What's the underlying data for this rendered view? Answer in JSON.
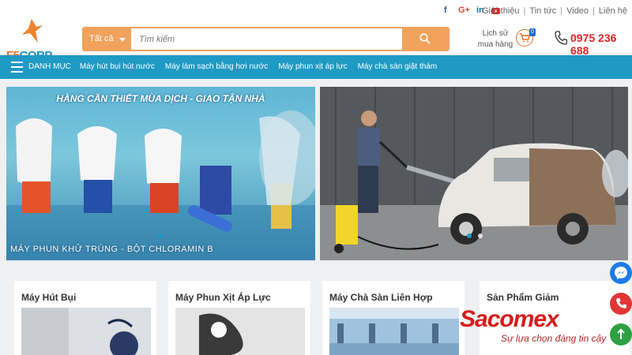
{
  "social": {
    "facebook": "f",
    "google": "G+",
    "linkedin": "in",
    "youtube": "youtube-icon"
  },
  "top_links": [
    "Giới thiệu",
    "Tin tức",
    "Video",
    "Liên hệ"
  ],
  "logo": {
    "text_a": "F5",
    "text_b": "CORP"
  },
  "search": {
    "category": "Tất cả",
    "placeholder": "Tìm kiếm"
  },
  "history": {
    "line1": "Lịch sử",
    "line2": "mua hàng"
  },
  "cart": {
    "count": "0"
  },
  "phone": "0975 236 688",
  "nav": {
    "menu_label": "DANH MỤC",
    "items": [
      "Máy hút bụi hút nước",
      "Máy làm sạch bằng hơi nước",
      "Máy phun xịt áp lực",
      "Máy chà sàn giặt thảm"
    ]
  },
  "banner_left": {
    "headline": "HÀNG CẦN THIẾT MÙA DỊCH - GIAO TẬN NHÀ",
    "caption": "MÁY PHUN KHỬ TRÙNG - BỘT CHLORAMIN B"
  },
  "cards": [
    {
      "title": "Máy Hút Bụi"
    },
    {
      "title": "Máy Phun Xịt Áp Lực"
    },
    {
      "title": "Máy Chà Sàn Liên Hợp"
    },
    {
      "title": "Sản Phẩm Giảm"
    }
  ],
  "watermark": {
    "brand": "Sacomex",
    "tagline": "Sự lựa chọn đáng tin cậy"
  },
  "colors": {
    "accent": "#f1a25c",
    "nav": "#1e9ac4",
    "phone": "#e02424"
  }
}
